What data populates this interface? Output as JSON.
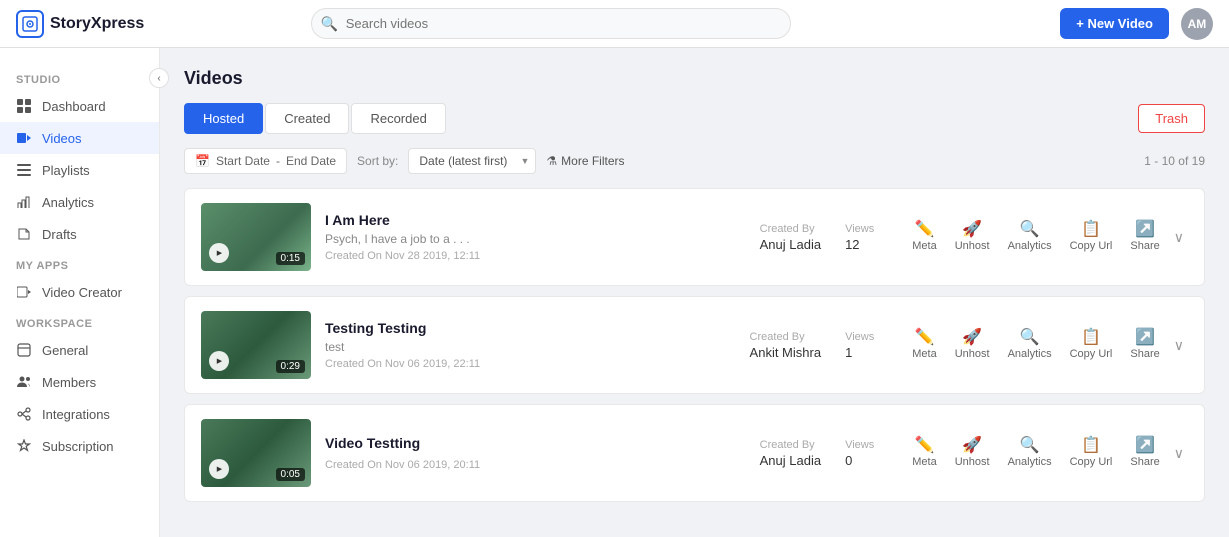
{
  "app": {
    "name": "StoryXpress",
    "logo_text": "StoryXpress"
  },
  "search": {
    "placeholder": "Search videos"
  },
  "topnav": {
    "new_video_label": "+ New Video",
    "avatar_initials": "AM"
  },
  "sidebar": {
    "sections": [
      {
        "label": "Studio",
        "items": [
          {
            "id": "dashboard",
            "label": "Dashboard",
            "icon": "grid"
          },
          {
            "id": "videos",
            "label": "Videos",
            "icon": "video",
            "active": true
          },
          {
            "id": "playlists",
            "label": "Playlists",
            "icon": "list"
          },
          {
            "id": "analytics",
            "label": "Analytics",
            "icon": "analytics"
          },
          {
            "id": "drafts",
            "label": "Drafts",
            "icon": "draft"
          }
        ]
      },
      {
        "label": "My Apps",
        "items": [
          {
            "id": "video-creator",
            "label": "Video Creator",
            "icon": "creator"
          }
        ]
      },
      {
        "label": "Workspace",
        "items": [
          {
            "id": "general",
            "label": "General",
            "icon": "general"
          },
          {
            "id": "members",
            "label": "Members",
            "icon": "members"
          },
          {
            "id": "integrations",
            "label": "Integrations",
            "icon": "integrations"
          },
          {
            "id": "subscription",
            "label": "Subscription",
            "icon": "subscription"
          }
        ]
      }
    ]
  },
  "page": {
    "title": "Videos",
    "tabs": [
      {
        "id": "hosted",
        "label": "Hosted",
        "active": true
      },
      {
        "id": "created",
        "label": "Created",
        "active": false
      },
      {
        "id": "recorded",
        "label": "Recorded",
        "active": false
      }
    ],
    "trash_label": "Trash",
    "date_start": "Start Date",
    "date_separator": "-",
    "date_end": "End Date",
    "sort_label": "Sort by:",
    "sort_value": "Date (latest first)",
    "more_filters": "More Filters",
    "results": "1 - 10 of 19"
  },
  "videos": [
    {
      "id": 1,
      "title": "I Am Here",
      "description": "Psych, I have a job to a . . .",
      "created_by_label": "Created By",
      "created_by": "Anuj Ladia",
      "created_on": "Created On Nov 28 2019, 12:11",
      "views_label": "Views",
      "views": "12",
      "duration": "0:15",
      "thumb_gradient": "linear-gradient(135deg, #5a8f6a 0%, #3d6b4f 60%, #7ab38a 100%)"
    },
    {
      "id": 2,
      "title": "Testing Testing",
      "description": "test",
      "created_by_label": "Created By",
      "created_by": "Ankit Mishra",
      "created_on": "Created On Nov 06 2019, 22:11",
      "views_label": "Views",
      "views": "1",
      "duration": "0:29",
      "thumb_gradient": "linear-gradient(135deg, #4a7a5a 0%, #2d5a3d 50%, #6a9a7a 100%)"
    },
    {
      "id": 3,
      "title": "Video Testting",
      "description": "",
      "created_by_label": "Created By",
      "created_by": "Anuj Ladia",
      "created_on": "Created On Nov 06 2019, 20:11",
      "views_label": "Views",
      "views": "0",
      "duration": "0:05",
      "thumb_gradient": "linear-gradient(135deg, #4a7a5a 0%, #2d5a3d 50%, #6a9a7a 100%)"
    }
  ],
  "actions": {
    "meta": "Meta",
    "unhost": "Unhost",
    "analytics": "Analytics",
    "copy_url": "Copy Url",
    "share": "Share"
  }
}
